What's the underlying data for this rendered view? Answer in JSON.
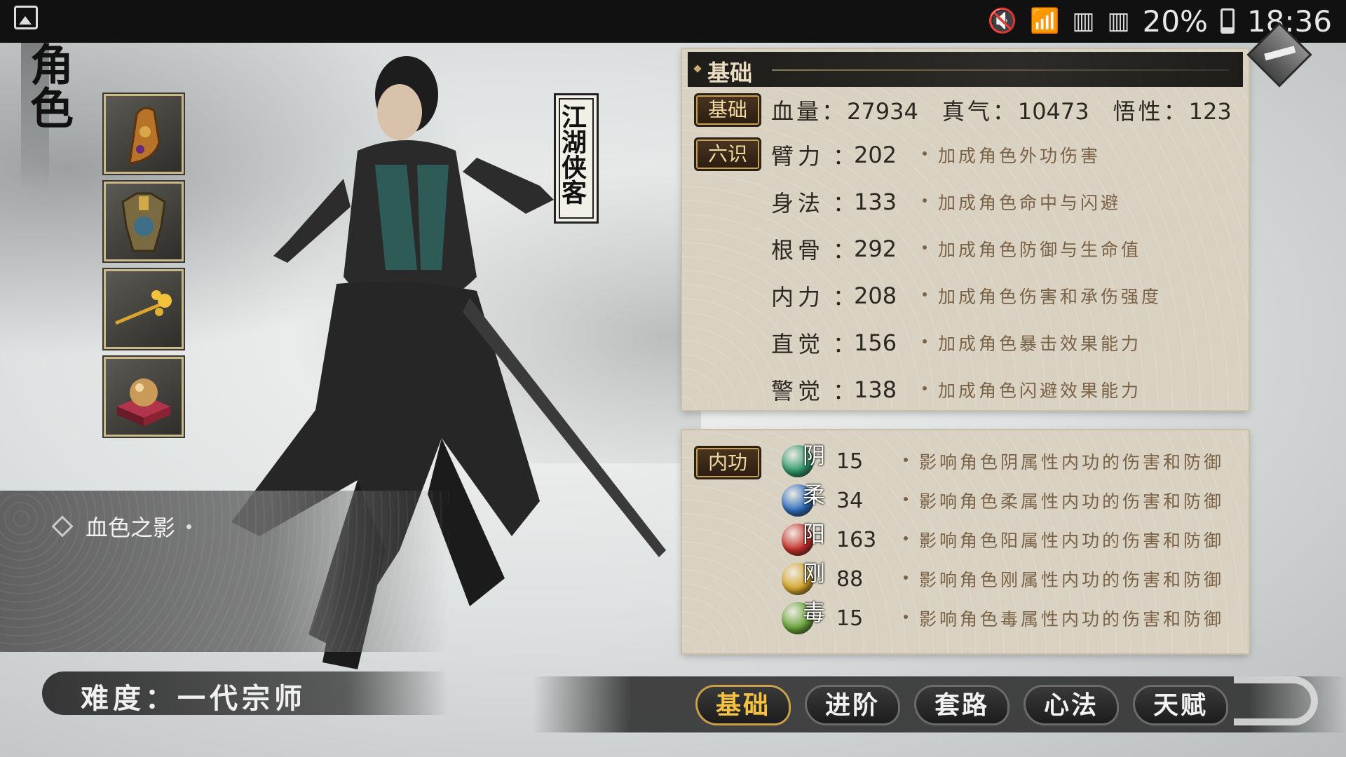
{
  "status_bar": {
    "battery": "20%",
    "time": "18:36",
    "icons": [
      "gallery-icon",
      "mute-icon",
      "wifi-icon",
      "sim1-icon",
      "sim2-icon",
      "battery-icon"
    ]
  },
  "screen_title": "角色",
  "equipment": [
    {
      "name": "gauntlet-icon"
    },
    {
      "name": "armor-icon"
    },
    {
      "name": "hairpin-icon"
    },
    {
      "name": "orb-pedestal-icon"
    }
  ],
  "character_title": "江湖侠客",
  "equip_set": "血色之影",
  "difficulty": "难度：一代宗师",
  "panel_basic": {
    "header": "基础",
    "tag_basic": "基础",
    "tag_six": "六识",
    "hp_label": "血量：",
    "hp": "27934",
    "qi_label": "真气：",
    "qi": "10473",
    "wux_label": "悟性：",
    "wux": "123",
    "stats": [
      {
        "label": "臂力",
        "value": "202",
        "desc": "加成角色外功伤害"
      },
      {
        "label": "身法",
        "value": "133",
        "desc": "加成角色命中与闪避"
      },
      {
        "label": "根骨",
        "value": "292",
        "desc": "加成角色防御与生命值"
      },
      {
        "label": "内力",
        "value": "208",
        "desc": "加成角色伤害和承伤强度"
      },
      {
        "label": "直觉",
        "value": "156",
        "desc": "加成角色暴击效果能力"
      },
      {
        "label": "警觉",
        "value": "138",
        "desc": "加成角色闪避效果能力"
      }
    ]
  },
  "panel_neigong": {
    "tag": "内功",
    "rows": [
      {
        "char": "阴",
        "value": "15",
        "desc": "影响角色阴属性内功的伤害和防御",
        "color": "#2f9a6a"
      },
      {
        "char": "柔",
        "value": "34",
        "desc": "影响角色柔属性内功的伤害和防御",
        "color": "#2f6fbf"
      },
      {
        "char": "阳",
        "value": "163",
        "desc": "影响角色阳属性内功的伤害和防御",
        "color": "#c8312a"
      },
      {
        "char": "刚",
        "value": "88",
        "desc": "影响角色刚属性内功的伤害和防御",
        "color": "#d8a72a"
      },
      {
        "char": "毒",
        "value": "15",
        "desc": "影响角色毒属性内功的伤害和防御",
        "color": "#6aa53a"
      }
    ]
  },
  "tabs": [
    "基础",
    "进阶",
    "套路",
    "心法",
    "天赋"
  ],
  "active_tab": "基础"
}
